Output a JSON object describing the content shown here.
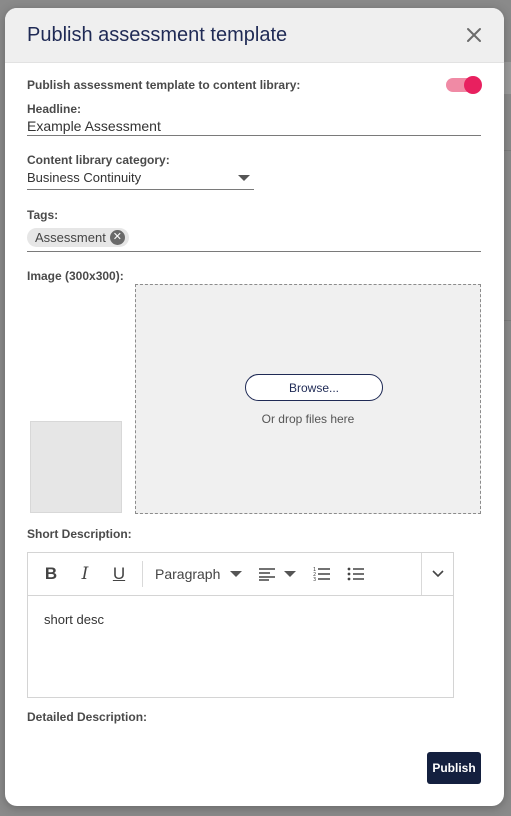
{
  "modal": {
    "title": "Publish assessment template",
    "close_icon": "close-icon"
  },
  "publish_toggle": {
    "label": "Publish assessment template to content library:",
    "checked": true,
    "accent": "#e8205f"
  },
  "headline": {
    "label": "Headline:",
    "value": "Example Assessment"
  },
  "category": {
    "label": "Content library category:",
    "selected": "Business Continuity"
  },
  "tags": {
    "label": "Tags:",
    "items": [
      "Assessment"
    ]
  },
  "image": {
    "label": "Image (300x300):",
    "browse_label": "Browse...",
    "drop_text": "Or drop files here"
  },
  "short_description": {
    "label": "Short Description:",
    "toolbar": {
      "bold": "B",
      "italic": "I",
      "underline": "U",
      "block_format": "Paragraph"
    },
    "content": "short desc"
  },
  "detailed_description": {
    "label": "Detailed Description:"
  },
  "footer": {
    "publish_label": "Publish",
    "button_color": "#14203f"
  }
}
